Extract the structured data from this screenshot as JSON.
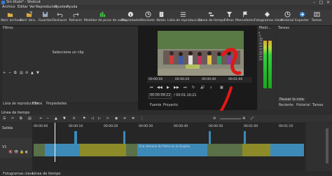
{
  "window": {
    "title": "Sin título* - Shotcut"
  },
  "menu": [
    "Archivo",
    "Editar",
    "Ver",
    "Reproductor",
    "Ajustes",
    "Ayuda"
  ],
  "toolbar": [
    {
      "label": "Abrir archivo",
      "icon": "folder-icon"
    },
    {
      "label": "Abrir otro...",
      "icon": "open-other-icon"
    },
    {
      "label": "Guardar",
      "icon": "save-icon"
    },
    {
      "label": "Deshacer",
      "icon": "undo-icon"
    },
    {
      "label": "Rehacer",
      "icon": "redo-icon"
    },
    {
      "label": "Medidor de picos de audio",
      "icon": "audio-peak-meter-icon"
    },
    {
      "label": "Propiedades",
      "icon": "properties-icon"
    },
    {
      "label": "Reciente",
      "icon": "recent-icon"
    },
    {
      "label": "Notas",
      "icon": "notes-icon"
    },
    {
      "label": "Lista de reproducción",
      "icon": "playlist-icon"
    },
    {
      "label": "Línea de tiempo",
      "icon": "timeline-icon"
    },
    {
      "label": "Filtros",
      "icon": "filters-icon"
    },
    {
      "label": "Marcadores",
      "icon": "markers-icon"
    },
    {
      "label": "Fotogramas clave",
      "icon": "keyframes-icon"
    },
    {
      "label": "Historial",
      "icon": "history-icon"
    },
    {
      "label": "Exportar",
      "icon": "export-icon"
    },
    {
      "label": "Tareas",
      "icon": "jobs-icon"
    }
  ],
  "filters_panel": {
    "title": "Filtros",
    "empty_label": "Seleccione un clip"
  },
  "left_tabs": [
    "Lista de reproducción",
    "Filtros",
    "Propiedades"
  ],
  "player": {
    "ruler_ticks": [
      "00:00:00",
      "00:00:20",
      "00:00:40",
      "00:01:00"
    ],
    "timecode_current": "00:00:09:22",
    "timecode_total": "/ 00:01:10:21",
    "source_tab": "Fuente",
    "project_tab": "Proyecto"
  },
  "meter": {
    "title": "Medi...",
    "scale": [
      "0",
      "-5",
      "-10",
      "-15",
      "-20",
      "-25",
      "-30",
      "-35",
      "-40",
      "-45",
      "-50"
    ]
  },
  "right_panel": {
    "title": "Tareas",
    "item": "Pausar la cola",
    "tabs": [
      "Reciente",
      "Historial",
      "Tareas"
    ]
  },
  "timeline": {
    "title": "Línea de tiempo",
    "ruler_ticks": [
      "00:00:00",
      "00:00:10",
      "00:00:20",
      "00:00:30",
      "00:00:40",
      "00:00:50",
      "00:01:00",
      "00:01:10"
    ],
    "output_label": "Salida",
    "track_label": "V1",
    "clip_text": "Una semana de Petra en la Guajira"
  },
  "bottom_tabs": [
    "Fotogramas clave",
    "Línea de tiempo"
  ],
  "colors": {
    "clip_blue": "#3d8ab8",
    "clip_olive": "#8d8a2a",
    "playhead": "#ffffff",
    "annotation_red": "#e01818"
  }
}
